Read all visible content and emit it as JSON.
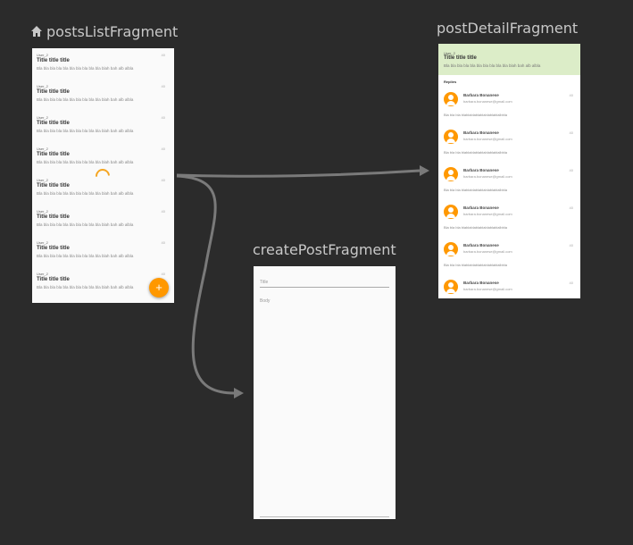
{
  "graph": {
    "posts_title": "postsListFragment",
    "detail_title": "postDetailFragment",
    "create_title": "createPostFragment"
  },
  "posts_list": {
    "items": [
      {
        "user": "User_2",
        "title": "Title title title",
        "body": "Bla bla bla bla bla bla bla bla bla bla blah bah alb albla",
        "id": "40"
      },
      {
        "user": "User_2",
        "title": "Title title title",
        "body": "Bla bla bla bla bla bla bla bla bla bla blah bah alb albla",
        "id": "40"
      },
      {
        "user": "User_2",
        "title": "Title title title",
        "body": "Bla bla bla bla bla bla bla bla bla bla blah bah alb albla",
        "id": "40"
      },
      {
        "user": "User_2",
        "title": "Title title title",
        "body": "Bla bla bla bla bla bla bla bla bla bla blah bah alb albla",
        "id": "40"
      },
      {
        "user": "User_2",
        "title": "Title title title",
        "body": "Bla bla bla bla bla bla bla bla bla bla blah bah alb albla",
        "id": "40"
      },
      {
        "user": "User_2",
        "title": "Title title title",
        "body": "Bla bla bla bla bla bla bla bla bla bla blah bah alb albla",
        "id": "40"
      },
      {
        "user": "User_2",
        "title": "Title title title",
        "body": "Bla bla bla bla bla bla bla bla bla bla blah bah alb albla",
        "id": "40"
      },
      {
        "user": "User_2",
        "title": "Title title title",
        "body": "Bla bla bla bla bla bla bla bla bla bla blah bah alb albla",
        "id": "40"
      }
    ],
    "fab_label": "+"
  },
  "post_detail": {
    "header": {
      "user": "User_2",
      "title": "Title title title",
      "body": "Bla bla bla bla bla bla bla bla bla bla blah bah alb albla"
    },
    "replies_label": "Replies",
    "replies": [
      {
        "name": "Barbara Bonanese",
        "email": "barbara.bonanese@gmail.com",
        "id": "40",
        "body": "Bla bla bla blablablablablablablablalbbla"
      },
      {
        "name": "Barbara Bonanese",
        "email": "barbara.bonanese@gmail.com",
        "id": "40",
        "body": "Bla bla bla blablablablablablablablalbbla"
      },
      {
        "name": "Barbara Bonanese",
        "email": "barbara.bonanese@gmail.com",
        "id": "40",
        "body": "Bla bla bla blablablablablablablablalbbla"
      },
      {
        "name": "Barbara Bonanese",
        "email": "barbara.bonanese@gmail.com",
        "id": "40",
        "body": "Bla bla bla blablablablablablablablalbbla"
      },
      {
        "name": "Barbara Bonanese",
        "email": "barbara.bonanese@gmail.com",
        "id": "40",
        "body": "Bla bla bla blablablablablablablablalbbla"
      },
      {
        "name": "Barbara Bonanese",
        "email": "barbara.bonanese@gmail.com",
        "id": "40",
        "body": ""
      }
    ]
  },
  "create_post": {
    "title_placeholder": "Title",
    "body_placeholder": "Body"
  },
  "icons": {
    "start_destination": "home-icon",
    "avatar": "person-icon"
  },
  "colors": {
    "background": "#2b2b2b",
    "accent": "#ff9800",
    "header": "#dcedc8",
    "arrow": "#7a7a7a"
  }
}
